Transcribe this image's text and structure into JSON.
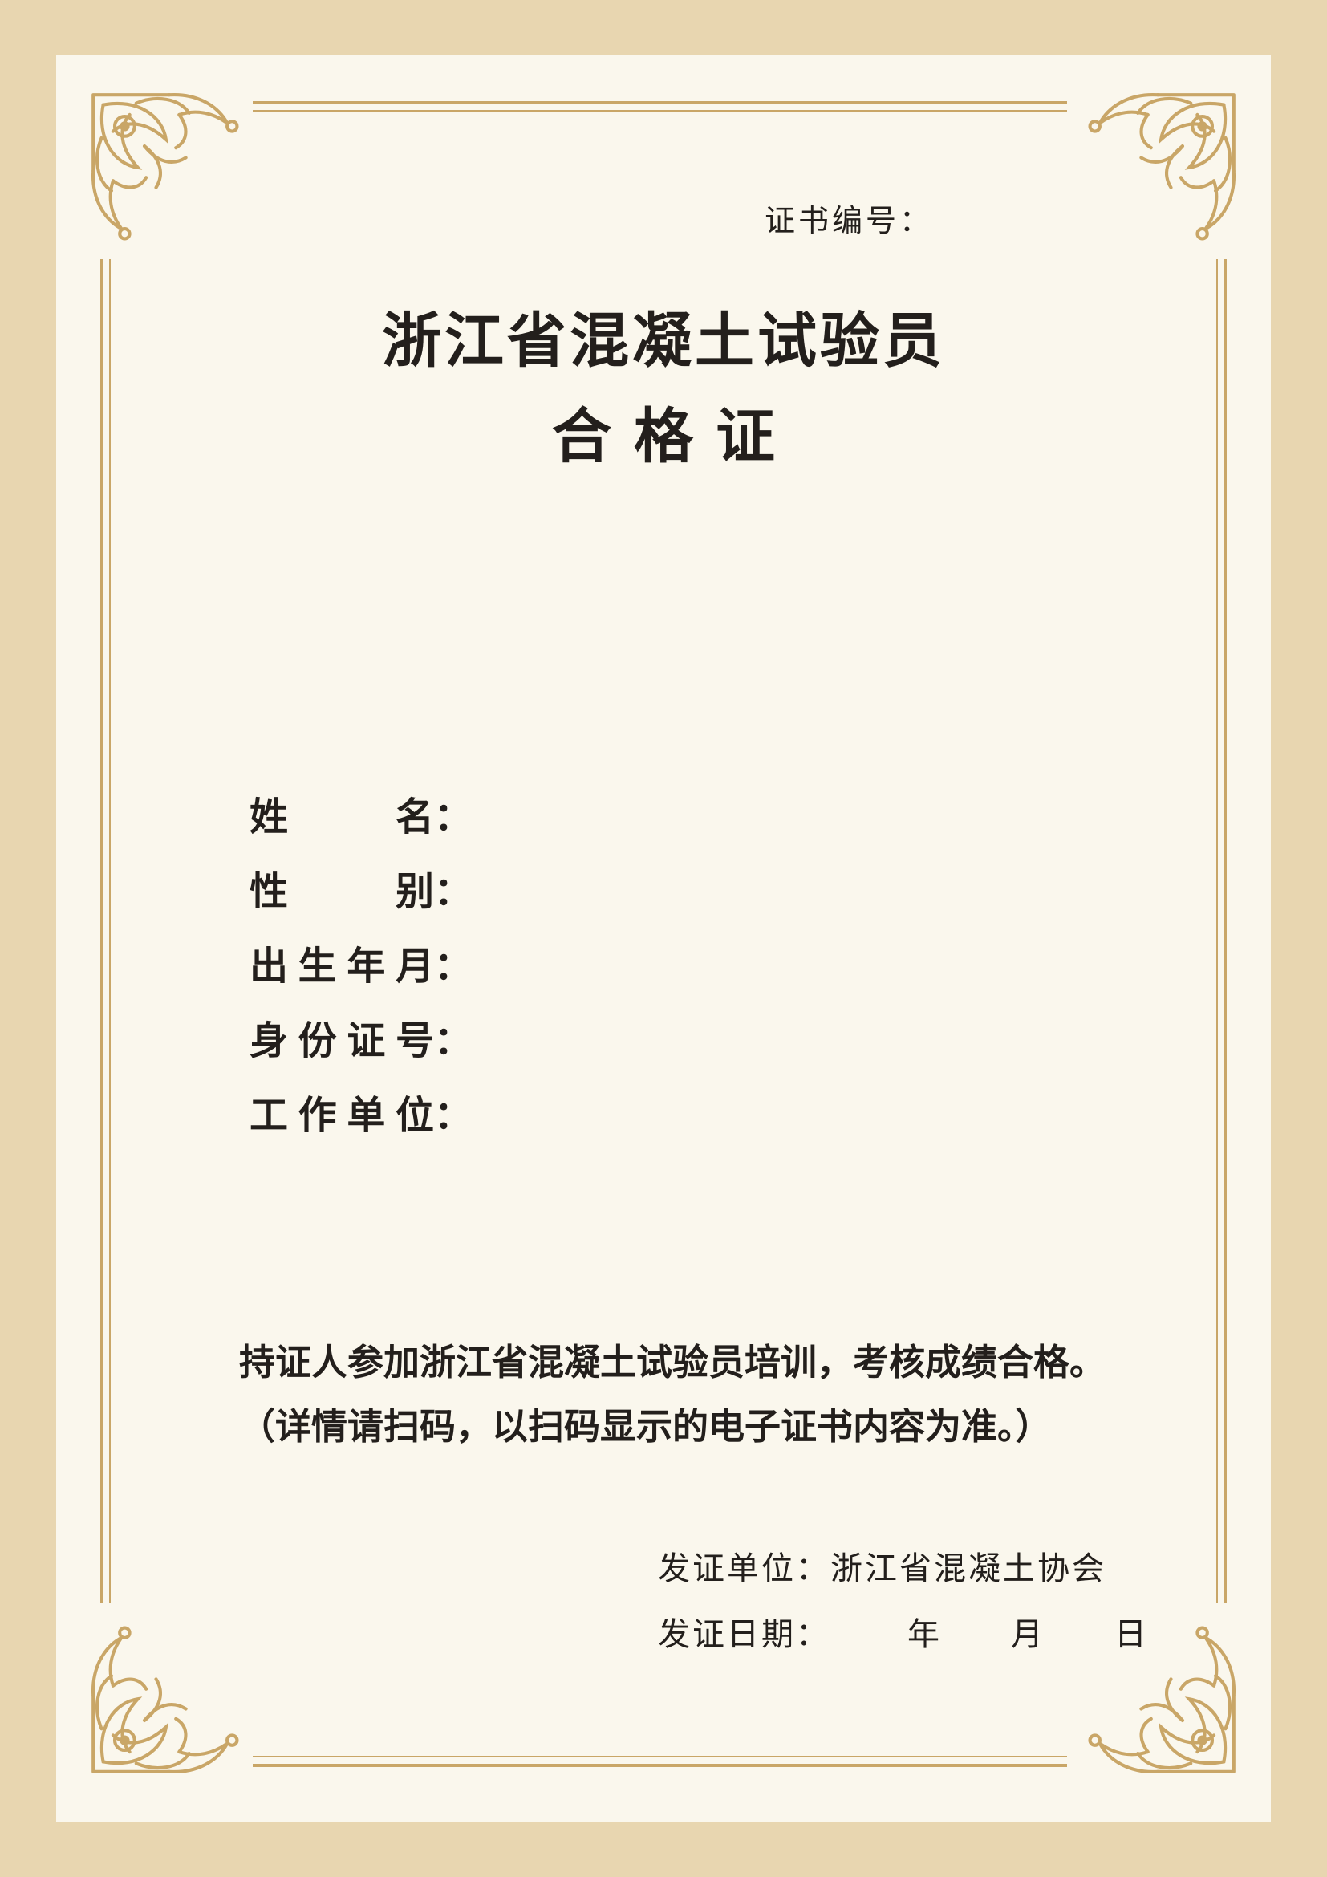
{
  "certificate": {
    "number_label": "证书编号：",
    "title": "浙江省混凝土试验员",
    "subtitle": "合格证",
    "fields": [
      {
        "label": "姓名",
        "colon": "："
      },
      {
        "label": "性别",
        "colon": "："
      },
      {
        "label": "出生年月",
        "colon": "："
      },
      {
        "label": "身份证号",
        "colon": "："
      },
      {
        "label": "工作单位",
        "colon": "："
      }
    ],
    "statement_line1": "持证人参加浙江省混凝土试验员培训，考核成绩合格。",
    "statement_line2": "（详情请扫码，以扫码显示的电子证书内容为准。）",
    "issuer_label": "发证单位：",
    "issuer_name": "浙江省混凝土协会",
    "date_label": "发证日期：",
    "date_year": "年",
    "date_month": "月",
    "date_day": "日"
  },
  "colors": {
    "outer_background": "#e8d6b0",
    "paper": "#faf7ed",
    "border_gold": "#c9a667",
    "text": "#231f1c"
  },
  "icons": {
    "corners": [
      "floral-corner-ornament-icon",
      "floral-corner-ornament-icon",
      "floral-corner-ornament-icon",
      "floral-corner-ornament-icon"
    ]
  }
}
